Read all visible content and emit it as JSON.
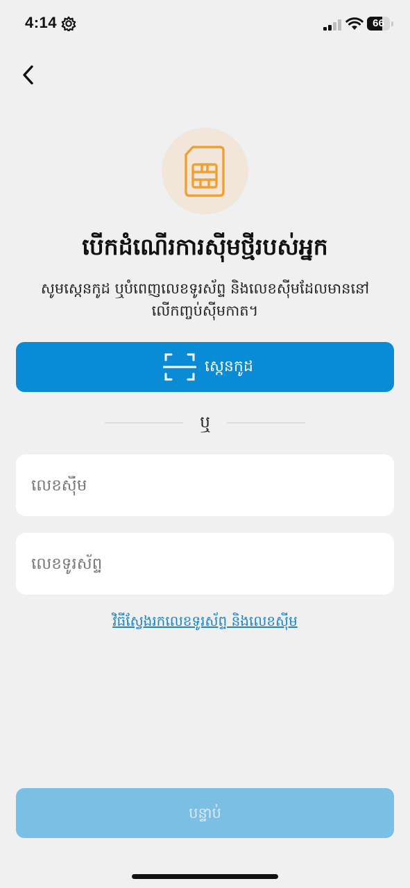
{
  "status_bar": {
    "time": "4:14",
    "battery_level": "66",
    "battery_fraction": 0.66,
    "signal_bars_active": 2,
    "signal_bars_total": 4
  },
  "icons": {
    "back": "chevron-left-icon",
    "settings": "gear-icon",
    "sim": "sim-card-icon",
    "scan": "scan-frame-icon"
  },
  "header": {
    "title": "បើកដំណើរការស៊ីមថ្មីរបស់អ្នក",
    "subtitle": "សូមស្កេនកូដ ឬបំពេញលេខទូរស័ព្ទ និងលេខស៊ីមដែលមាននៅលើកញ្ចប់ស៊ីមកាត។"
  },
  "scan_button": {
    "label": "ស្កេនកូដ"
  },
  "divider": {
    "label": "ឬ"
  },
  "form": {
    "sim_number": {
      "placeholder": "លេខស៊ីម",
      "value": ""
    },
    "phone_number": {
      "placeholder": "លេខទូរស័ព្ទ",
      "value": ""
    }
  },
  "help_link": {
    "label": "វិធីស្វែងរកលេខទូរស័ព្ទ និងលេខស៊ីម"
  },
  "next_button": {
    "label": "បន្ទាប់",
    "enabled": false
  },
  "colors": {
    "background": "#f0f0f0",
    "primary_blue": "#0a8bd6",
    "disabled_blue": "#7cbfe4",
    "link_blue": "#1a86c8",
    "sim_orange": "#f0a030",
    "sim_badge_bg": "#f2e6da"
  }
}
